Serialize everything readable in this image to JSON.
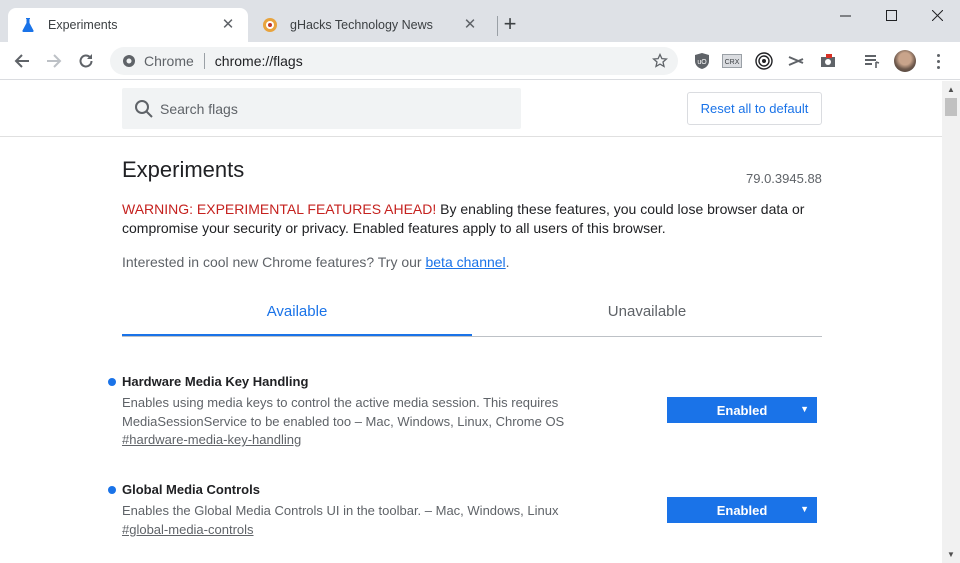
{
  "tabs": [
    {
      "title": "Experiments",
      "icon": "flask-icon",
      "active": true
    },
    {
      "title": "gHacks Technology News",
      "icon": "ghacks-icon",
      "active": false
    }
  ],
  "omnibox": {
    "site_chip": "Chrome",
    "url": "chrome://flags"
  },
  "extensions": [
    "ublock-icon",
    "crx-icon",
    "fingerprint-icon",
    "scissors-icon",
    "camera-icon",
    "media-queue-icon"
  ],
  "header": {
    "search_placeholder": "Search flags",
    "reset_label": "Reset all to default"
  },
  "main": {
    "title": "Experiments",
    "version": "79.0.3945.88",
    "warning_label": "WARNING: EXPERIMENTAL FEATURES AHEAD!",
    "warning_text": " By enabling these features, you could lose browser data or compromise your security or privacy. Enabled features apply to all users of this browser.",
    "interest_text": "Interested in cool new Chrome features? Try our ",
    "interest_link": "beta channel",
    "interest_end": ".",
    "tab_available": "Available",
    "tab_unavailable": "Unavailable"
  },
  "flags": [
    {
      "name": "Hardware Media Key Handling",
      "desc": "Enables using media keys to control the active media session. This requires MediaSessionService to be enabled too – Mac, Windows, Linux, Chrome OS",
      "anchor": "#hardware-media-key-handling",
      "value": "Enabled"
    },
    {
      "name": "Global Media Controls",
      "desc": "Enables the Global Media Controls UI in the toolbar. – Mac, Windows, Linux",
      "anchor": "#global-media-controls",
      "value": "Enabled"
    }
  ],
  "colors": {
    "accent": "#1a73e8",
    "warning": "#c5221f",
    "tabstrip": "#dee1e6"
  }
}
